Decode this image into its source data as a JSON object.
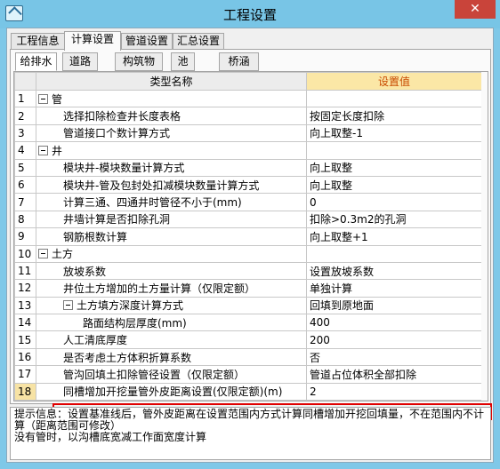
{
  "window": {
    "title": "工程设置",
    "close_label": "✕"
  },
  "tabs": [
    "工程信息",
    "计算设置",
    "管道设置",
    "汇总设置"
  ],
  "active_tab": "计算设置",
  "subtabs": [
    "给排水",
    "道路",
    "构筑物",
    "池",
    "桥涵"
  ],
  "active_subtab": "给排水",
  "grid": {
    "header_name": "类型名称",
    "header_value": "设置值",
    "rows": [
      {
        "num": "1",
        "name": "管",
        "value": "",
        "level": 0,
        "toggle": true
      },
      {
        "num": "2",
        "name": "选择扣除检查井长度表格",
        "value": "按固定长度扣除",
        "level": 1
      },
      {
        "num": "3",
        "name": "管道接口个数计算方式",
        "value": "向上取整-1",
        "level": 1
      },
      {
        "num": "4",
        "name": "井",
        "value": "",
        "level": 0,
        "toggle": true
      },
      {
        "num": "5",
        "name": "模块井-模块数量计算方式",
        "value": "向上取整",
        "level": 1
      },
      {
        "num": "6",
        "name": "模块井-管及包封处扣减模块数量计算方式",
        "value": "向上取整",
        "level": 1
      },
      {
        "num": "7",
        "name": "计算三通、四通井时管径不小于(mm)",
        "value": "0",
        "level": 1
      },
      {
        "num": "8",
        "name": "井墙计算是否扣除孔洞",
        "value": "扣除>0.3m2的孔洞",
        "level": 1
      },
      {
        "num": "9",
        "name": "钢筋根数计算",
        "value": "向上取整+1",
        "level": 1
      },
      {
        "num": "10",
        "name": "土方",
        "value": "",
        "level": 0,
        "toggle": true
      },
      {
        "num": "11",
        "name": "放坡系数",
        "value": "设置放坡系数",
        "level": 1
      },
      {
        "num": "12",
        "name": "井位土方增加的土方量计算（仅限定额）",
        "value": "单独计算",
        "level": 1
      },
      {
        "num": "13",
        "name": "土方填方深度计算方式",
        "value": "回填到原地面",
        "level": 1,
        "toggle": true
      },
      {
        "num": "14",
        "name": "路面结构层厚度(mm)",
        "value": "400",
        "level": 2
      },
      {
        "num": "15",
        "name": "人工清底厚度",
        "value": "200",
        "level": 1
      },
      {
        "num": "16",
        "name": "是否考虑土方体积折算系数",
        "value": "否",
        "level": 1
      },
      {
        "num": "17",
        "name": "管沟回填土扣除管径设置（仅限定额）",
        "value": "管道占位体积全部扣除",
        "level": 1
      },
      {
        "num": "18",
        "name": "同槽增加开挖量管外皮距离设置(仅限定额)(m)",
        "value": "2",
        "level": 1,
        "selected": true
      }
    ]
  },
  "hint": {
    "line1": "提示信息：设置基准线后，管外皮距离在设置范围内方式计算同槽增加开挖回填量，不在范围内不计",
    "line2": "算（距离范围可修改）",
    "line3": "没有管时，以沟槽底宽减工作面宽度计算"
  },
  "colors": {
    "highlight_box": "#e00000",
    "value_header_bg": "#fbe7a6",
    "titlebar": "#78c5e6"
  }
}
